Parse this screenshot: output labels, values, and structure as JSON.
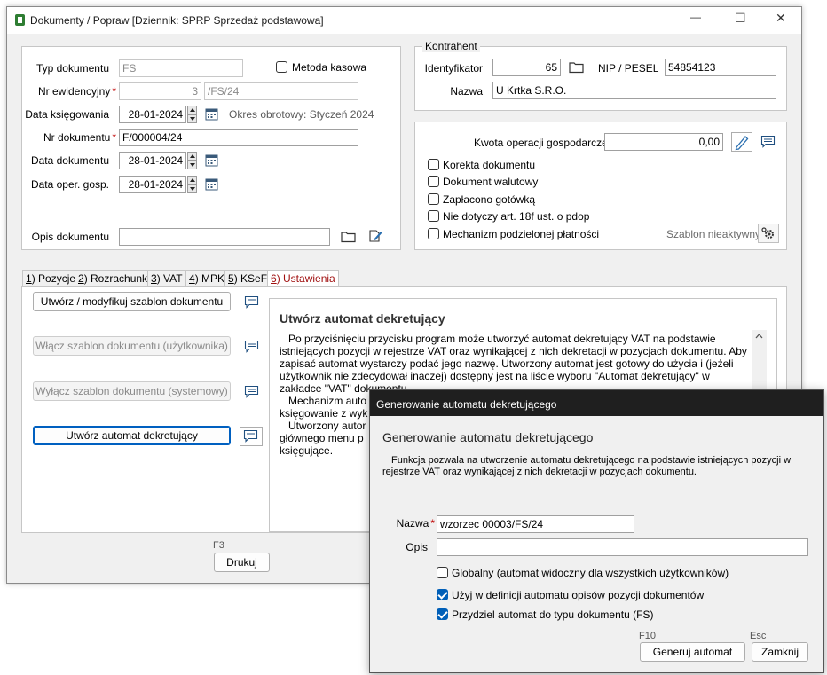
{
  "window": {
    "title": "Dokumenty / Popraw [Dziennik: SPRP  Sprzedaż podstawowa]",
    "controls": {
      "minimize": "—",
      "maximize": "☐",
      "close": "✕"
    }
  },
  "form": {
    "typ_dokumentu": {
      "label": "Typ dokumentu",
      "value": "FS"
    },
    "metoda_kasowa": {
      "label": "Metoda kasowa",
      "checked": false
    },
    "nr_ewidencyjny": {
      "label": "Nr ewidencyjny",
      "req": "*",
      "number": "3",
      "suffix": "/FS/24"
    },
    "data_ksiegowania": {
      "label": "Data księgowania",
      "value": "28-01-2024",
      "note": "Okres obrotowy: Styczeń 2024"
    },
    "nr_dokumentu": {
      "label": "Nr dokumentu",
      "req": "*",
      "value": "F/000004/24"
    },
    "data_dokumentu": {
      "label": "Data dokumentu",
      "value": "28-01-2024"
    },
    "data_oper": {
      "label": "Data oper. gosp.",
      "value": "28-01-2024"
    },
    "opis_dokumentu": {
      "label": "Opis dokumentu",
      "value": ""
    }
  },
  "kontrahent": {
    "group_label": "Kontrahent",
    "identyfikator": {
      "label": "Identyfikator",
      "value": "65"
    },
    "nip": {
      "label": "NIP / PESEL",
      "value": "54854123"
    },
    "nazwa": {
      "label": "Nazwa",
      "value": "U Krtka S.R.O."
    }
  },
  "operacja": {
    "kwota": {
      "label": "Kwota operacji gospodarczej",
      "value": "0,00"
    },
    "checks": [
      {
        "label": "Korekta dokumentu",
        "checked": false
      },
      {
        "label": "Dokument walutowy",
        "checked": false
      },
      {
        "label": "Zapłacono gotówką",
        "checked": false
      },
      {
        "label": "Nie dotyczy art. 18f ust. o pdop",
        "checked": false
      },
      {
        "label": "Mechanizm podzielonej płatności",
        "checked": false
      }
    ],
    "szablon": "Szablon nieaktywny"
  },
  "tabs": [
    {
      "key": "1",
      "label": ") Pozycje"
    },
    {
      "key": "2",
      "label": ") Rozrachunki"
    },
    {
      "key": "3",
      "label": ") VAT"
    },
    {
      "key": "4",
      "label": ") MPK"
    },
    {
      "key": "5",
      "label": ") KSeF"
    },
    {
      "key": "6",
      "label": ") Ustawienia"
    }
  ],
  "ustawienia": {
    "buttons": [
      "Utwórz / modyfikuj szablon dokumentu",
      "Włącz szablon dokumentu (użytkownika)",
      "Wyłącz szablon dokumentu (systemowy)",
      "Utwórz automat dekretujący"
    ],
    "help_title": "Utwórz automat dekretujący",
    "help_p1": "Po przyciśnięciu przycisku program może utworzyć automat dekretujący VAT na podstawie istniejących pozycji w rejestrze VAT oraz wynikającej z nich dekretacji w pozycjach dokumentu. Aby zapisać automat wystarczy podać jego nazwę. Utworzony automat jest gotowy do użycia i (jeżeli użytkownik nie zdecydował inaczej) dostępny jest na liście wyboru \"Automat dekretujący\" w zakładce \"VAT\" dokumentu.",
    "help_p2a": "Mechanizm auto",
    "help_p2b": "księgowanie z wyk",
    "help_p3a": "Utworzony autor",
    "help_p3b": "głównego menu p",
    "help_p3c": "księgujące."
  },
  "footer": {
    "shortcut": "F3",
    "print": "Drukuj"
  },
  "dialog": {
    "title": "Generowanie automatu dekretującego",
    "heading": "Generowanie automatu dekretującego",
    "description": "Funkcja pozwala na utworzenie automatu dekretującego na podstawie istniejących pozycji w rejestrze VAT oraz wynikającej z nich dekretacji w pozycjach dokumentu.",
    "nazwa": {
      "label": "Nazwa",
      "req": "*",
      "value": "wzorzec 00003/FS/24"
    },
    "opis": {
      "label": "Opis",
      "value": ""
    },
    "checks": [
      {
        "label": "Globalny (automat widoczny dla wszystkich użytkowników)",
        "checked": false
      },
      {
        "label": "Użyj w definicji automatu opisów pozycji dokumentów",
        "checked": true
      },
      {
        "label": "Przydziel automat do typu dokumentu (FS)",
        "checked": true
      }
    ],
    "generate": {
      "shortcut": "F10",
      "label": "Generuj automat"
    },
    "close": {
      "shortcut": "Esc",
      "label": "Zamknij"
    }
  },
  "colors": {
    "accent": "#005fb8",
    "required": "#c00000",
    "active_tab": "#a01010",
    "dialog_titlebar": "#1f1f1f"
  }
}
